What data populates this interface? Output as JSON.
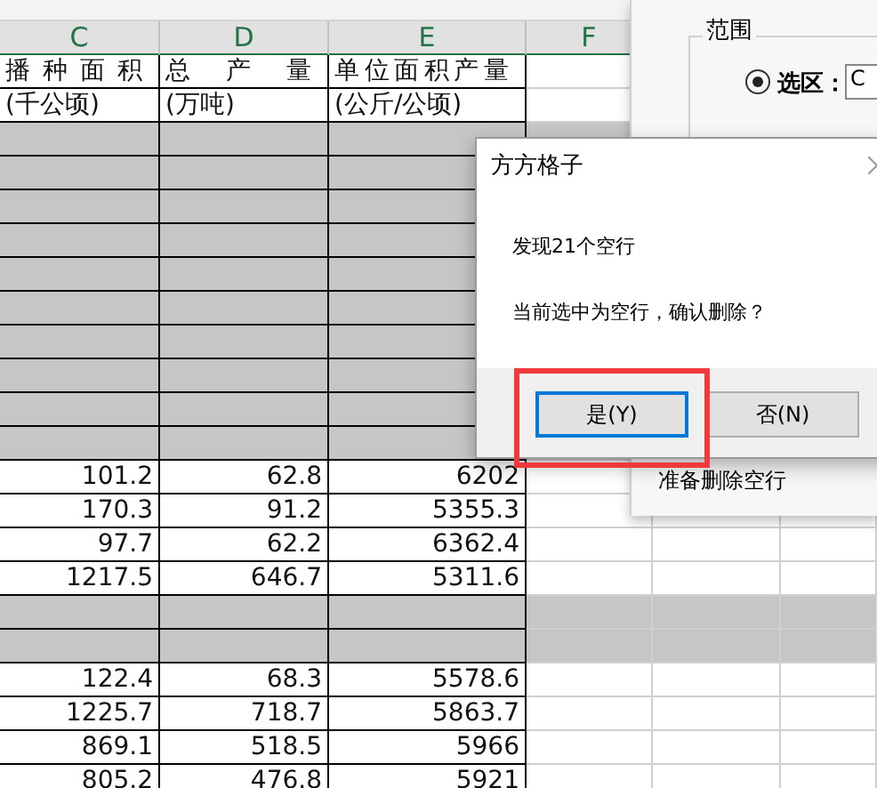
{
  "columns": [
    "C",
    "D",
    "E",
    "F"
  ],
  "rows": [
    {
      "kind": "title",
      "cells": [
        "播 种 面 积",
        "总 产 量",
        "单位面积产量"
      ]
    },
    {
      "kind": "unit",
      "cells": [
        "(千公顷)",
        "(万吨)",
        "(公斤/公顷)"
      ]
    },
    {
      "kind": "blank",
      "selected": true
    },
    {
      "kind": "blank",
      "selected": true
    },
    {
      "kind": "blank",
      "selected": true
    },
    {
      "kind": "blank",
      "selected": true
    },
    {
      "kind": "blank",
      "selected": true
    },
    {
      "kind": "blank",
      "selected": true
    },
    {
      "kind": "blank",
      "selected": true
    },
    {
      "kind": "blank",
      "selected": true
    },
    {
      "kind": "blank",
      "selected": true
    },
    {
      "kind": "blank",
      "selected": true
    },
    {
      "kind": "data",
      "cells": [
        "101.2",
        "62.8",
        "6202"
      ]
    },
    {
      "kind": "data",
      "cells": [
        "170.3",
        "91.2",
        "5355.3"
      ]
    },
    {
      "kind": "data",
      "cells": [
        "97.7",
        "62.2",
        "6362.4"
      ]
    },
    {
      "kind": "data",
      "cells": [
        "1217.5",
        "646.7",
        "5311.6"
      ]
    },
    {
      "kind": "blank",
      "selected": true
    },
    {
      "kind": "blank",
      "selected": true
    },
    {
      "kind": "data",
      "cells": [
        "122.4",
        "68.3",
        "5578.6"
      ]
    },
    {
      "kind": "data",
      "cells": [
        "1225.7",
        "718.7",
        "5863.7"
      ]
    },
    {
      "kind": "data",
      "cells": [
        "869.1",
        "518.5",
        "5966"
      ]
    },
    {
      "kind": "data",
      "cells": [
        "805.2",
        "476.8",
        "5921"
      ]
    }
  ],
  "range_panel": {
    "group_title": "范围",
    "option": {
      "label": "选区：",
      "selected": true
    },
    "field_value": "C",
    "status": "准备删除空行"
  },
  "dialog": {
    "title": "方方格子",
    "message": "发现21个空行",
    "question": "当前选中为空行，确认删除？",
    "buttons": [
      {
        "label": "是(Y)",
        "default": true
      },
      {
        "label": "否(N)",
        "default": false
      }
    ]
  }
}
